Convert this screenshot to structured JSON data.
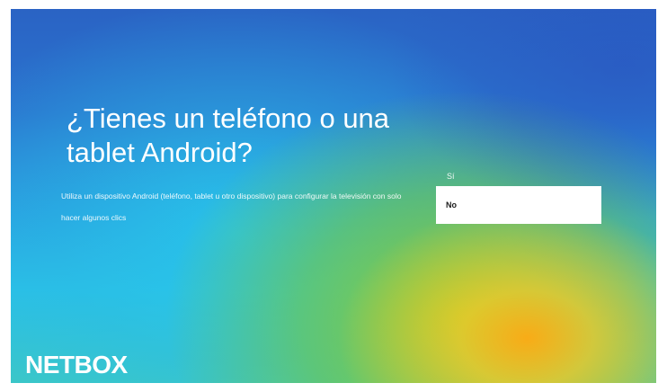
{
  "setup": {
    "title": "¿Tienes un teléfono o una tablet Android?",
    "description": "Utiliza un dispositivo Android (teléfono, tablet u otro dispositivo) para configurar la televisión con solo hacer algunos clics",
    "options": [
      {
        "label": "Sí",
        "selected": false
      },
      {
        "label": "No",
        "selected": true
      }
    ]
  },
  "brand": {
    "logo_text": "NETBOX"
  },
  "colors": {
    "background_top": "#2a63c4",
    "background_mid": "#2bbfe6",
    "background_glow_green": "#96cd28",
    "background_glow_yellow": "#ffaa14",
    "selected_option_bg": "#ffffff",
    "text": "#ffffff"
  }
}
